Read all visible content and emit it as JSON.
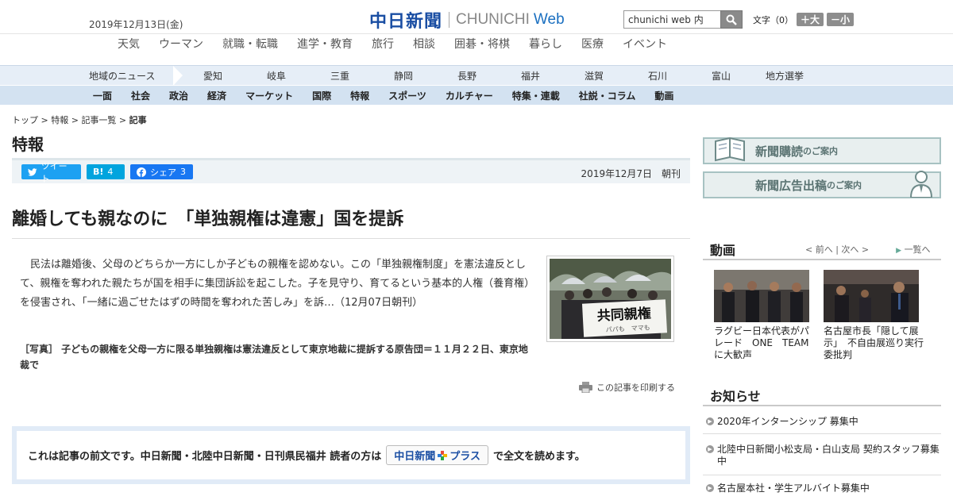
{
  "header": {
    "date": "2019年12月13日(金)",
    "logo_jp": "中日新聞",
    "logo_en": "CHUNICHI",
    "logo_web": "Web",
    "search_value": "chunichi web 内",
    "fontsize_label": "文字",
    "fontsize_value": "（0）",
    "bigger": "＋大",
    "smaller": "－小"
  },
  "genre_nav": [
    "天気",
    "ウーマン",
    "就職・転職",
    "進学・教育",
    "旅行",
    "相談",
    "囲碁・将棋",
    "暮らし",
    "医療",
    "イベント"
  ],
  "region_nav": {
    "title": "地域のニュース",
    "items": [
      "愛知",
      "岐阜",
      "三重",
      "静岡",
      "長野",
      "福井",
      "滋賀",
      "石川",
      "富山",
      "地方選挙"
    ]
  },
  "main_nav": [
    "一面",
    "社会",
    "政治",
    "経済",
    "マーケット",
    "国際",
    "特報",
    "スポーツ",
    "カルチャー",
    "特集・連載",
    "社説・コラム",
    "動画"
  ],
  "breadcrumb": {
    "items": [
      "トップ",
      "特報",
      "記事一覧"
    ],
    "current": "記事"
  },
  "section_title": "特報",
  "share": {
    "tweet": "ツイート",
    "hatena_label": "B!",
    "hatena_count": "4",
    "fb_label": "シェア",
    "fb_count": "3"
  },
  "article": {
    "pub_date": "2019年12月7日　朝刊",
    "headline": "離婚しても親なのに　「単独親権は違憲」国を提訴",
    "body": "民法は離婚後、父母のどちらか一方にしか子どもの親権を認めない。この「単独親権制度」を憲法違反として、親権を奪われた親たちが国を相手に集団訴訟を起こした。子を見守り、育てるという基本的人権（養育権）を侵害され、「一緒に過ごせたはずの時間を奪われた苦しみ」を訴…（12月07日朝刊）",
    "photo_sign": "共同親権",
    "photo_sign_sub": "パパも　ママも",
    "caption": "［写真］ 子どもの親権を父母一方に限る単独親権は憲法違反として東京地裁に提訴する原告団＝１１月２２日、東京地裁で",
    "print_label": "この記事を印刷する"
  },
  "paywall": {
    "text_before": "これは記事の前文です。中日新聞・北陸中日新聞・日刊県民福井 読者の方は",
    "badge_jp": "中日新聞",
    "badge_plus": "プラス",
    "text_after": "で全文を読めます。"
  },
  "sidebar": {
    "banner1_main": "新聞購読",
    "banner1_sub": "のご案内",
    "banner2_main": "新聞広告出稿",
    "banner2_sub": "のご案内",
    "video_head": "動画",
    "video_prev": "< 前へ",
    "video_next": "次へ >",
    "video_list": "一覧へ",
    "videos": [
      {
        "title": "ラグビー日本代表がパレード　ONE　TEAMに大歓声"
      },
      {
        "title": "名古屋市長「隠して展示」　不自由展巡り実行委批判"
      }
    ],
    "notice_head": "お知らせ",
    "notices": [
      "2020年インターンシップ 募集中",
      "北陸中日新聞小松支局・白山支局 契約スタッフ募集中",
      "名古屋本社・学生アルバイト募集中"
    ]
  },
  "colors": {
    "logo_blue": "#1a4ea3",
    "nav_light": "#e6eef7",
    "nav_main": "#d3e2f1",
    "twitter": "#1da1f2",
    "hatena": "#00a4de",
    "facebook": "#1877f2"
  }
}
